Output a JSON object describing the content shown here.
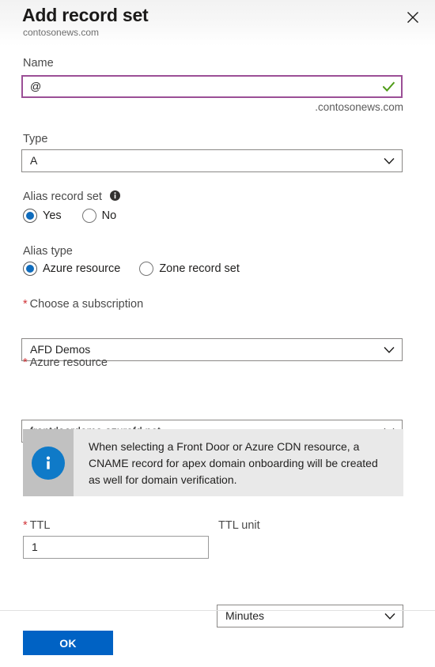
{
  "header": {
    "title": "Add record set",
    "subtitle": "contosonews.com",
    "close_icon": "close-icon"
  },
  "form": {
    "name": {
      "label": "Name",
      "value": "@",
      "placeholder": "",
      "valid_icon": "checkmark-icon",
      "suffix": ".contosonews.com"
    },
    "type": {
      "label": "Type",
      "value": "A",
      "chevron_icon": "chevron-down-icon"
    },
    "alias_record_set": {
      "label": "Alias record set",
      "info_icon": "info-icon",
      "options": [
        {
          "label": "Yes",
          "checked": true
        },
        {
          "label": "No",
          "checked": false
        }
      ]
    },
    "alias_type": {
      "label": "Alias type",
      "options": [
        {
          "label": "Azure resource",
          "checked": true
        },
        {
          "label": "Zone record set",
          "checked": false
        }
      ]
    },
    "subscription": {
      "required_marker": "*",
      "label": "Choose a subscription",
      "value": "AFD Demos",
      "chevron_icon": "chevron-down-icon"
    },
    "azure_resource": {
      "required_marker": "*",
      "label": "Azure resource",
      "value": "frontdoordemo.azurefd.net",
      "chevron_icon": "chevron-down-icon"
    },
    "info_banner": {
      "icon": "info-icon",
      "text": "When selecting a Front Door or Azure CDN resource, a CNAME record for apex domain onboarding will be created as well for domain verification."
    },
    "ttl": {
      "required_marker": "*",
      "label": "TTL",
      "value": "1"
    },
    "ttl_unit": {
      "label": "TTL unit",
      "value": "Minutes",
      "chevron_icon": "chevron-down-icon"
    }
  },
  "footer": {
    "ok_label": "OK"
  },
  "colors": {
    "accent": "#0062c4",
    "focus_border": "#9b4f96",
    "valid_check": "#4f9c18",
    "required_star": "#d13438",
    "info_icon_bg": "#0f7ac8"
  }
}
